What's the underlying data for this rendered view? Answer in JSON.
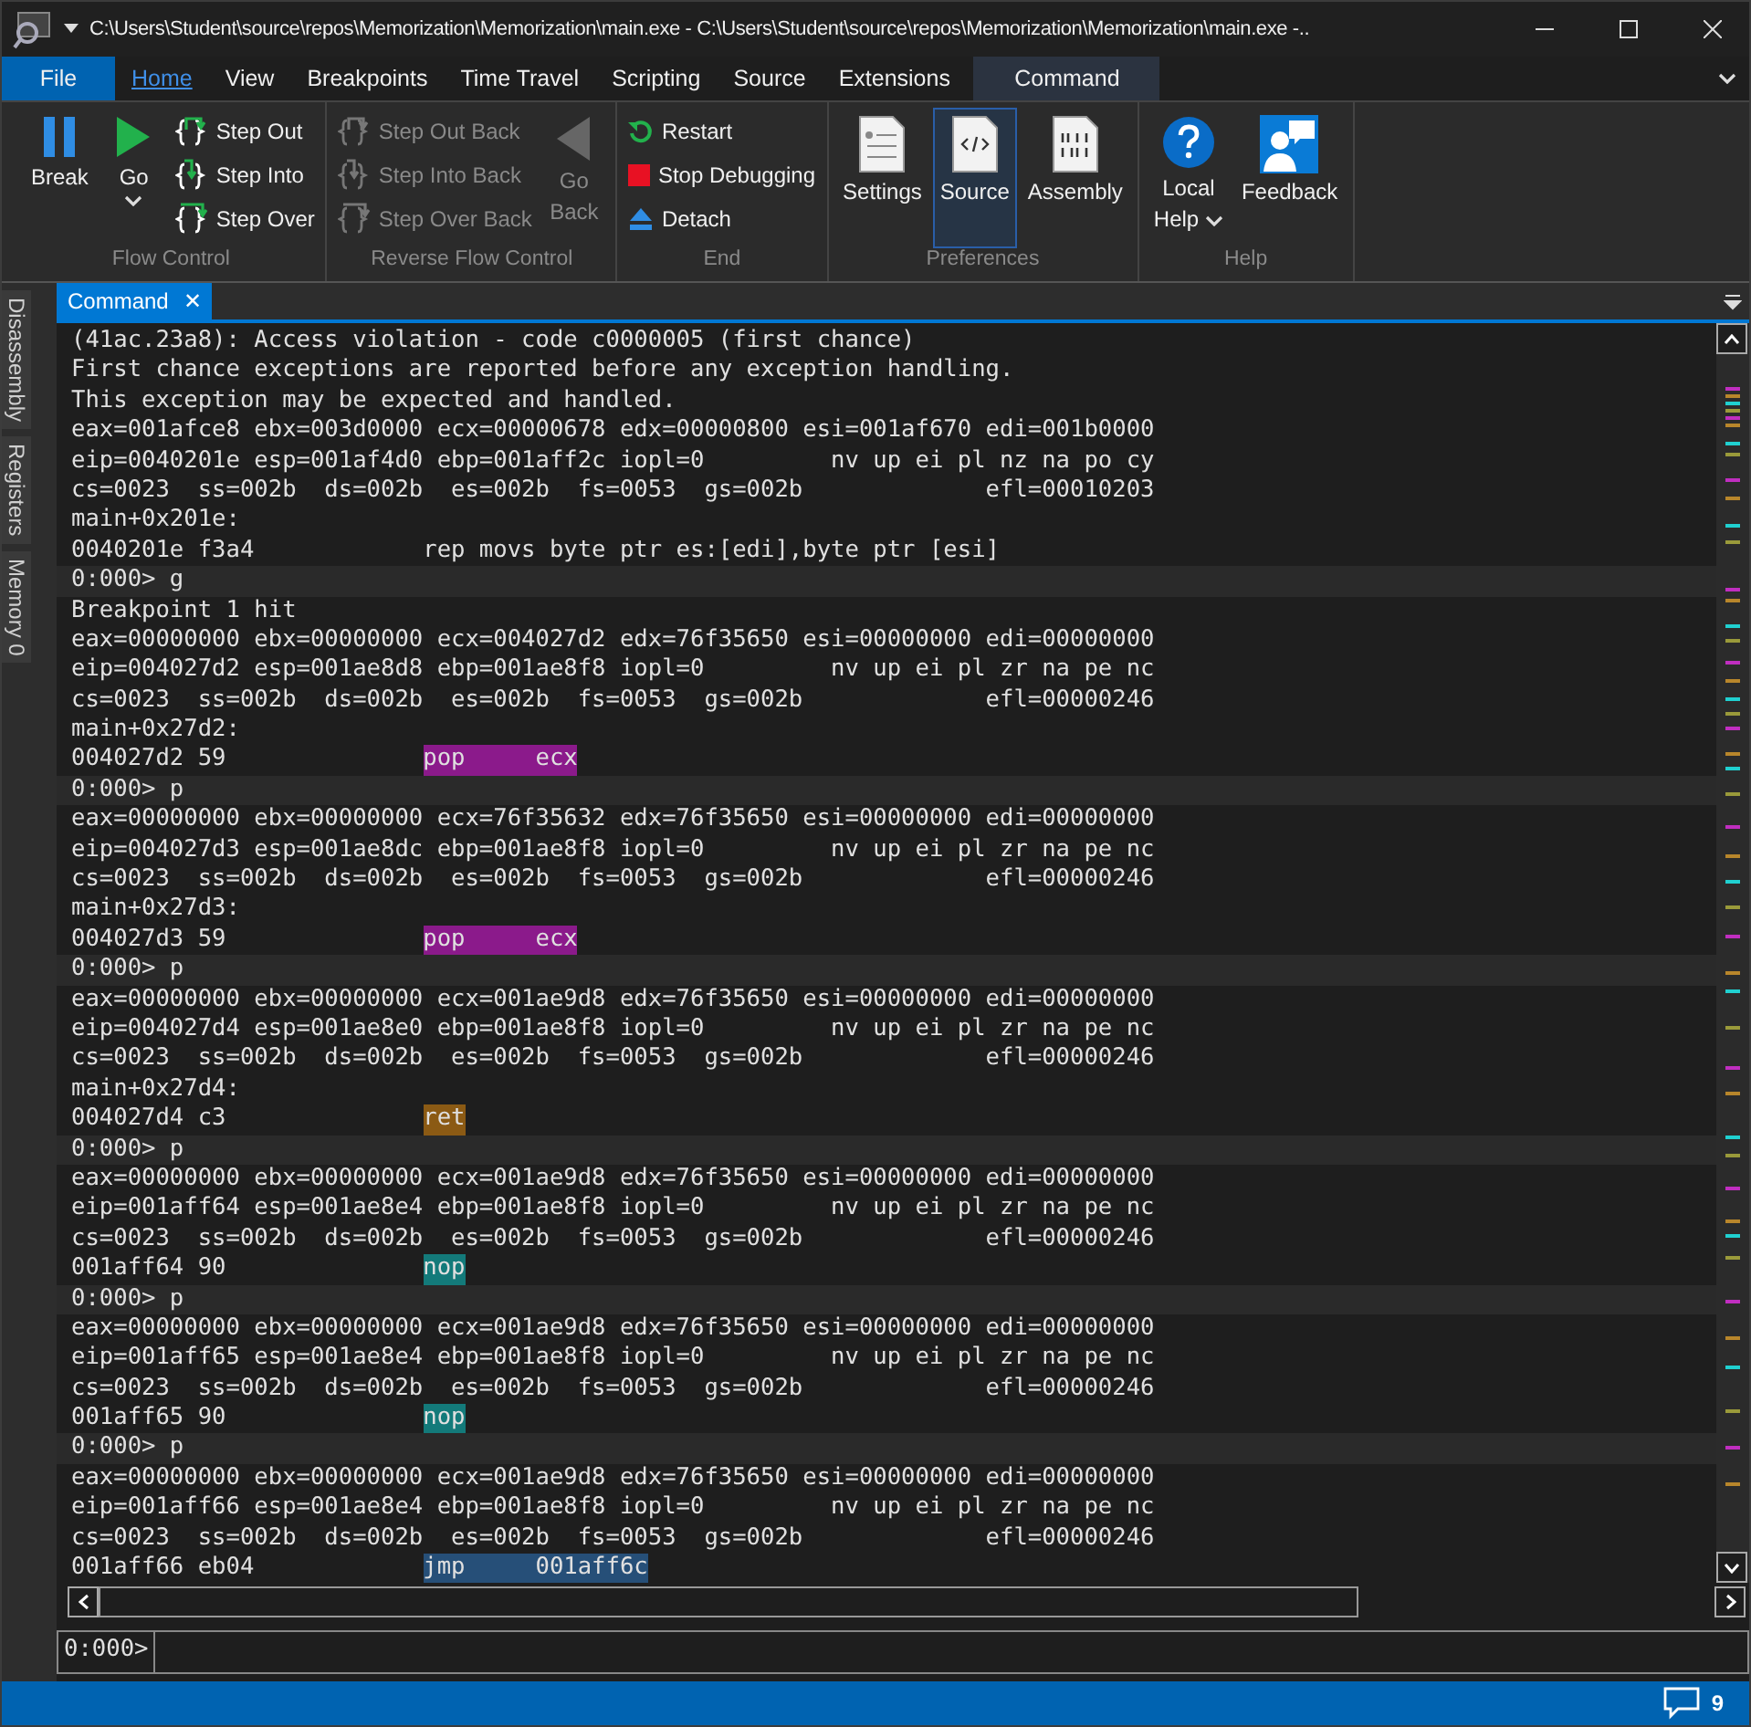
{
  "window": {
    "title": "C:\\Users\\Student\\source\\repos\\Memorization\\Memorization\\main.exe - C:\\Users\\Student\\source\\repos\\Memorization\\Memorization\\main.exe -.."
  },
  "menu_tabs": [
    {
      "label": "File",
      "kind": "file",
      "selected": false
    },
    {
      "label": "Home",
      "kind": "tab",
      "selected": true
    },
    {
      "label": "View",
      "kind": "tab",
      "selected": false
    },
    {
      "label": "Breakpoints",
      "kind": "tab",
      "selected": false
    },
    {
      "label": "Time Travel",
      "kind": "tab",
      "selected": false
    },
    {
      "label": "Scripting",
      "kind": "tab",
      "selected": false
    },
    {
      "label": "Source",
      "kind": "tab",
      "selected": false
    },
    {
      "label": "Extensions",
      "kind": "tab",
      "selected": false
    },
    {
      "label": "Command",
      "kind": "contextual",
      "selected": false
    }
  ],
  "ribbon_groups": [
    {
      "label": "Flow Control",
      "items": [
        {
          "kind": "big",
          "label": "Break",
          "disabled": false
        },
        {
          "kind": "big",
          "label": "Go",
          "dropdown": true,
          "disabled": false
        },
        {
          "kind": "stack",
          "items": [
            {
              "label": "Step Out",
              "disabled": false
            },
            {
              "label": "Step Into",
              "disabled": false
            },
            {
              "label": "Step Over",
              "disabled": false
            }
          ]
        }
      ]
    },
    {
      "label": "Reverse Flow Control",
      "items": [
        {
          "kind": "stack",
          "items": [
            {
              "label": "Step Out Back",
              "disabled": true
            },
            {
              "label": "Step Into Back",
              "disabled": true
            },
            {
              "label": "Step Over Back",
              "disabled": true
            }
          ]
        },
        {
          "kind": "big2",
          "label": "Go",
          "label2": "Back",
          "disabled": true
        }
      ]
    },
    {
      "label": "End",
      "items": [
        {
          "kind": "stack",
          "items": [
            {
              "label": "Restart",
              "disabled": false
            },
            {
              "label": "Stop Debugging",
              "disabled": false
            },
            {
              "label": "Detach",
              "disabled": false
            }
          ]
        }
      ]
    },
    {
      "label": "Preferences",
      "items": [
        {
          "kind": "big",
          "label": "Settings",
          "selected": false,
          "disabled": false
        },
        {
          "kind": "big",
          "label": "Source",
          "selected": true,
          "disabled": false
        },
        {
          "kind": "big",
          "label": "Assembly",
          "selected": false,
          "disabled": false
        }
      ]
    },
    {
      "label": "Help",
      "items": [
        {
          "kind": "big2",
          "label": "Local",
          "label2": "Help",
          "dropdown": true,
          "disabled": false
        },
        {
          "kind": "big",
          "label": "Feedback",
          "disabled": false
        }
      ]
    }
  ],
  "side_tabs": [
    "Disassembly",
    "Registers",
    "Memory 0"
  ],
  "document_tab": {
    "label": "Command",
    "close": "✕"
  },
  "output": [
    {
      "kind": "text",
      "text": "(41ac.23a8): Access violation - code c0000005 (first chance)"
    },
    {
      "kind": "text",
      "text": "First chance exceptions are reported before any exception handling."
    },
    {
      "kind": "text",
      "text": "This exception may be expected and handled."
    },
    {
      "kind": "text",
      "text": "eax=001afce8 ebx=003d0000 ecx=00000678 edx=00000800 esi=001af670 edi=001b0000"
    },
    {
      "kind": "text",
      "text": "eip=0040201e esp=001af4d0 ebp=001aff2c iopl=0         nv up ei pl nz na po cy"
    },
    {
      "kind": "text",
      "text": "cs=0023  ss=002b  ds=002b  es=002b  fs=0053  gs=002b             efl=00010203"
    },
    {
      "kind": "text",
      "text": "main+0x201e:"
    },
    {
      "kind": "asm",
      "text": "0040201e f3a4",
      "instruction": "rep movs byte ptr es:[edi],byte ptr [esi]"
    },
    {
      "kind": "prompt",
      "text": "0:000> g"
    },
    {
      "kind": "text",
      "text": "Breakpoint 1 hit"
    },
    {
      "kind": "text",
      "text": "eax=00000000 ebx=00000000 ecx=004027d2 edx=76f35650 esi=00000000 edi=00000000"
    },
    {
      "kind": "text",
      "text": "eip=004027d2 esp=001ae8d8 ebp=001ae8f8 iopl=0         nv up ei pl zr na pe nc"
    },
    {
      "kind": "text",
      "text": "cs=0023  ss=002b  ds=002b  es=002b  fs=0053  gs=002b             efl=00000246"
    },
    {
      "kind": "text",
      "text": "main+0x27d2:"
    },
    {
      "kind": "asm",
      "text": "004027d2 59",
      "instruction": "pop     ecx",
      "color": "#8b1a8b"
    },
    {
      "kind": "prompt",
      "text": "0:000> p"
    },
    {
      "kind": "text",
      "text": "eax=00000000 ebx=00000000 ecx=76f35632 edx=76f35650 esi=00000000 edi=00000000"
    },
    {
      "kind": "text",
      "text": "eip=004027d3 esp=001ae8dc ebp=001ae8f8 iopl=0         nv up ei pl zr na pe nc"
    },
    {
      "kind": "text",
      "text": "cs=0023  ss=002b  ds=002b  es=002b  fs=0053  gs=002b             efl=00000246"
    },
    {
      "kind": "text",
      "text": "main+0x27d3:"
    },
    {
      "kind": "asm",
      "text": "004027d3 59",
      "instruction": "pop     ecx",
      "color": "#8b1a8b"
    },
    {
      "kind": "prompt",
      "text": "0:000> p"
    },
    {
      "kind": "text",
      "text": "eax=00000000 ebx=00000000 ecx=001ae9d8 edx=76f35650 esi=00000000 edi=00000000"
    },
    {
      "kind": "text",
      "text": "eip=004027d4 esp=001ae8e0 ebp=001ae8f8 iopl=0         nv up ei pl zr na pe nc"
    },
    {
      "kind": "text",
      "text": "cs=0023  ss=002b  ds=002b  es=002b  fs=0053  gs=002b             efl=00000246"
    },
    {
      "kind": "text",
      "text": "main+0x27d4:"
    },
    {
      "kind": "asm",
      "text": "004027d4 c3",
      "instruction": "ret",
      "color": "#8b5a14"
    },
    {
      "kind": "prompt",
      "text": "0:000> p"
    },
    {
      "kind": "text",
      "text": "eax=00000000 ebx=00000000 ecx=001ae9d8 edx=76f35650 esi=00000000 edi=00000000"
    },
    {
      "kind": "text",
      "text": "eip=001aff64 esp=001ae8e4 ebp=001ae8f8 iopl=0         nv up ei pl zr na pe nc"
    },
    {
      "kind": "text",
      "text": "cs=0023  ss=002b  ds=002b  es=002b  fs=0053  gs=002b             efl=00000246"
    },
    {
      "kind": "asm",
      "text": "001aff64 90",
      "instruction": "nop",
      "color": "#137a7a"
    },
    {
      "kind": "prompt",
      "text": "0:000> p"
    },
    {
      "kind": "text",
      "text": "eax=00000000 ebx=00000000 ecx=001ae9d8 edx=76f35650 esi=00000000 edi=00000000"
    },
    {
      "kind": "text",
      "text": "eip=001aff65 esp=001ae8e4 ebp=001ae8f8 iopl=0         nv up ei pl zr na pe nc"
    },
    {
      "kind": "text",
      "text": "cs=0023  ss=002b  ds=002b  es=002b  fs=0053  gs=002b             efl=00000246"
    },
    {
      "kind": "asm",
      "text": "001aff65 90",
      "instruction": "nop",
      "color": "#137a7a"
    },
    {
      "kind": "prompt",
      "text": "0:000> p"
    },
    {
      "kind": "text",
      "text": "eax=00000000 ebx=00000000 ecx=001ae9d8 edx=76f35650 esi=00000000 edi=00000000"
    },
    {
      "kind": "text",
      "text": "eip=001aff66 esp=001ae8e4 ebp=001ae8f8 iopl=0         nv up ei pl zr na pe nc"
    },
    {
      "kind": "text",
      "text": "cs=0023  ss=002b  ds=002b  es=002b  fs=0053  gs=002b             efl=00000246"
    },
    {
      "kind": "asm",
      "text": "001aff66 eb04",
      "instruction": "jmp     001aff6c",
      "color": "#264f78"
    }
  ],
  "command_input": {
    "prompt": "0:000>"
  },
  "status_bar": {
    "notifications": "9"
  }
}
